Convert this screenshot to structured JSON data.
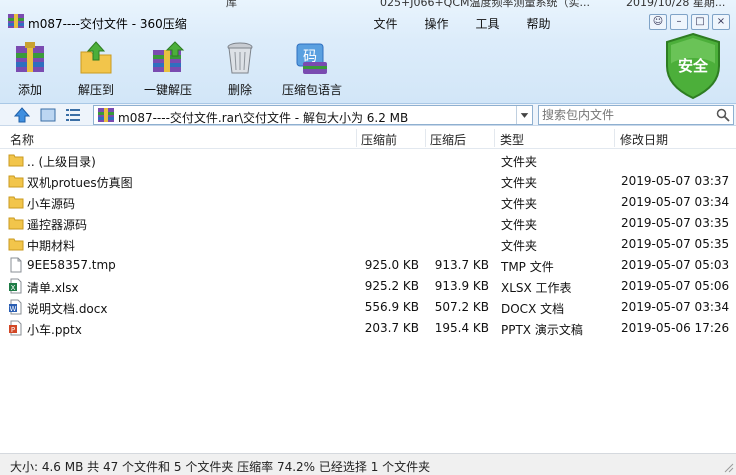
{
  "window": {
    "title": "m087----交付文件 - 360压缩",
    "behind_text_1": "库",
    "behind_text_2": "025+J066+QCM温度频率测量系统（实...",
    "behind_text_3": "2019/10/28 星期..."
  },
  "menu": [
    "文件",
    "操作",
    "工具",
    "帮助"
  ],
  "toolbar": [
    {
      "label": "添加",
      "icon": "add-archive-icon"
    },
    {
      "label": "解压到",
      "icon": "extract-to-icon"
    },
    {
      "label": "一键解压",
      "icon": "one-click-extract-icon"
    },
    {
      "label": "删除",
      "icon": "trash-icon"
    },
    {
      "label": "压缩包语言",
      "icon": "language-code-icon"
    }
  ],
  "security_badge": "安全",
  "address": {
    "path": "m087----交付文件.rar\\交付文件 - 解包大小为 6.2 MB",
    "search_placeholder": "搜索包内文件"
  },
  "columns": {
    "name": "名称",
    "packed": "压缩前",
    "unpacked": "压缩后",
    "type": "类型",
    "date": "修改日期"
  },
  "files": [
    {
      "name": ".. (上级目录)",
      "packed": "",
      "unpacked": "",
      "type": "文件夹",
      "date": "",
      "icon": "folder-icon"
    },
    {
      "name": "双机protues仿真图",
      "packed": "",
      "unpacked": "",
      "type": "文件夹",
      "date": "2019-05-07 03:37",
      "icon": "folder-icon"
    },
    {
      "name": "小车源码",
      "packed": "",
      "unpacked": "",
      "type": "文件夹",
      "date": "2019-05-07 03:34",
      "icon": "folder-icon"
    },
    {
      "name": "遥控器源码",
      "packed": "",
      "unpacked": "",
      "type": "文件夹",
      "date": "2019-05-07 03:35",
      "icon": "folder-icon"
    },
    {
      "name": "中期材料",
      "packed": "",
      "unpacked": "",
      "type": "文件夹",
      "date": "2019-05-07 05:35",
      "icon": "folder-icon"
    },
    {
      "name": "9EE58357.tmp",
      "packed": "925.0 KB",
      "unpacked": "913.7 KB",
      "type": "TMP 文件",
      "date": "2019-05-07 05:03",
      "icon": "blank-file-icon"
    },
    {
      "name": "清单.xlsx",
      "packed": "925.2 KB",
      "unpacked": "913.9 KB",
      "type": "XLSX 工作表",
      "date": "2019-05-07 05:06",
      "icon": "excel-file-icon"
    },
    {
      "name": "说明文档.docx",
      "packed": "556.9 KB",
      "unpacked": "507.2 KB",
      "type": "DOCX 文档",
      "date": "2019-05-07 03:34",
      "icon": "word-file-icon"
    },
    {
      "name": "小车.pptx",
      "packed": "203.7 KB",
      "unpacked": "195.4 KB",
      "type": "PPTX 演示文稿",
      "date": "2019-05-06 17:26",
      "icon": "powerpoint-file-icon"
    }
  ],
  "status": "大小: 4.6 MB 共 47 个文件和 5 个文件夹 压缩率 74.2% 已经选择 1 个文件夹",
  "colors": {
    "toolbar_bg": "#dcecfa",
    "folder": "#f2c54b",
    "shield": "#4caf3a",
    "excel": "#1e7b45",
    "word": "#2b5fb3",
    "powerpoint": "#d24726"
  }
}
